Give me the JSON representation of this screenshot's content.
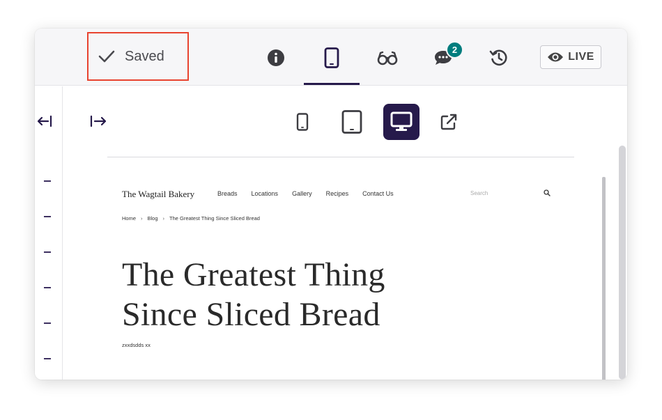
{
  "header": {
    "status_label": "Saved",
    "comments_count": "2",
    "live_label": "LIVE",
    "icons": [
      "check-icon",
      "info-icon",
      "mobile-preview-icon",
      "glasses-icon",
      "comments-icon",
      "history-icon",
      "eye-icon"
    ]
  },
  "preview_toolbar": {
    "devices": [
      "mobile",
      "tablet",
      "desktop"
    ],
    "active_device": "desktop",
    "icons": [
      "collapse-left-icon",
      "expand-right-icon",
      "mobile-icon",
      "tablet-icon",
      "desktop-icon",
      "external-link-icon"
    ]
  },
  "site": {
    "logo": "The Wagtail Bakery",
    "nav": [
      "Breads",
      "Locations",
      "Gallery",
      "Recipes",
      "Contact Us"
    ],
    "search_placeholder": "Search",
    "breadcrumb": [
      "Home",
      "Blog",
      "The Greatest Thing Since Sliced Bread"
    ],
    "title_line1": "The Greatest Thing",
    "title_line2": "Since Sliced Bread",
    "subtitle": "zxxdsdds xx"
  },
  "colors": {
    "accent": "#261a4b",
    "highlight_border": "#e8432f",
    "badge": "#007d7e"
  }
}
